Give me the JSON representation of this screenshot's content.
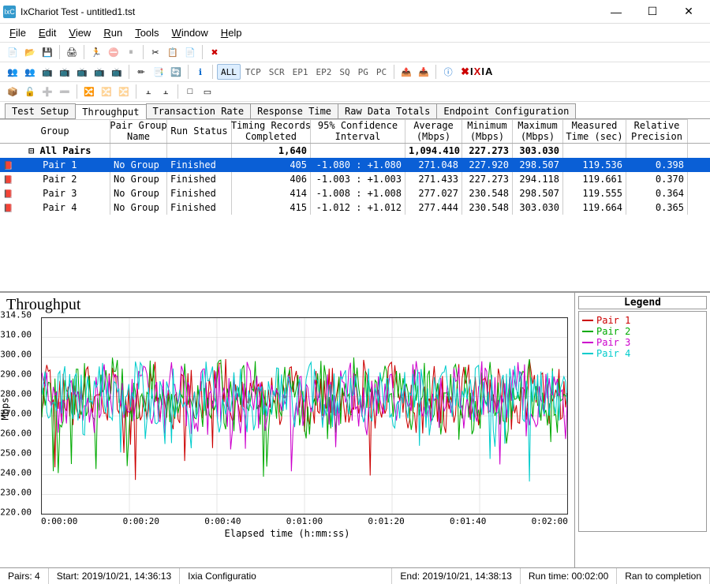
{
  "window": {
    "title": "IxChariot Test - untitled1.tst"
  },
  "menu": {
    "file": "File",
    "edit": "Edit",
    "view": "View",
    "run": "Run",
    "tools": "Tools",
    "window": "Window",
    "help": "Help"
  },
  "toolbar2": {
    "all": "ALL",
    "tcp": "TCP",
    "scr": "SCR",
    "ep1": "EP1",
    "ep2": "EP2",
    "sq": "SQ",
    "pg": "PG",
    "pc": "PC"
  },
  "tabs": [
    "Test Setup",
    "Throughput",
    "Transaction Rate",
    "Response Time",
    "Raw Data Totals",
    "Endpoint Configuration"
  ],
  "activeTab": 1,
  "columns": [
    "Group",
    "Pair Group\nName",
    "Run Status",
    "Timing Records\nCompleted",
    "95% Confidence\nInterval",
    "Average\n(Mbps)",
    "Minimum\n(Mbps)",
    "Maximum\n(Mbps)",
    "Measured\nTime (sec)",
    "Relative\nPrecision"
  ],
  "summary": {
    "label": "All Pairs",
    "timing": "1,640",
    "avg": "1,094.410",
    "min": "227.273",
    "max": "303.030"
  },
  "rows": [
    {
      "group": "Pair 1",
      "pg": "No Group",
      "status": "Finished",
      "timing": "405",
      "ci": "-1.080 : +1.080",
      "avg": "271.048",
      "min": "227.920",
      "max": "298.507",
      "time": "119.536",
      "prec": "0.398",
      "sel": true
    },
    {
      "group": "Pair 2",
      "pg": "No Group",
      "status": "Finished",
      "timing": "406",
      "ci": "-1.003 : +1.003",
      "avg": "271.433",
      "min": "227.273",
      "max": "294.118",
      "time": "119.661",
      "prec": "0.370",
      "sel": false
    },
    {
      "group": "Pair 3",
      "pg": "No Group",
      "status": "Finished",
      "timing": "414",
      "ci": "-1.008 : +1.008",
      "avg": "277.027",
      "min": "230.548",
      "max": "298.507",
      "time": "119.555",
      "prec": "0.364",
      "sel": false
    },
    {
      "group": "Pair 4",
      "pg": "No Group",
      "status": "Finished",
      "timing": "415",
      "ci": "-1.012 : +1.012",
      "avg": "277.444",
      "min": "230.548",
      "max": "303.030",
      "time": "119.664",
      "prec": "0.365",
      "sel": false
    }
  ],
  "chart_data": {
    "type": "line",
    "title": "Throughput",
    "ylabel": "Mbps",
    "xlabel": "Elapsed time (h:mm:ss)",
    "ylim": [
      215,
      315
    ],
    "yticks": [
      "314.50",
      "310.00",
      "300.00",
      "290.00",
      "280.00",
      "270.00",
      "260.00",
      "250.00",
      "240.00",
      "230.00",
      "220.00"
    ],
    "xticks": [
      "0:00:00",
      "0:00:20",
      "0:00:40",
      "0:01:00",
      "0:01:20",
      "0:01:40",
      "0:02:00"
    ],
    "series": [
      {
        "name": "Pair 1",
        "color": "#cc0000"
      },
      {
        "name": "Pair 2",
        "color": "#00aa00"
      },
      {
        "name": "Pair 3",
        "color": "#cc00cc"
      },
      {
        "name": "Pair 4",
        "color": "#00cccc"
      }
    ],
    "note": "Each series is noisy throughput ~230-300 Mbps over 0-120s; individual points approximated visually."
  },
  "legend_title": "Legend",
  "status": {
    "pairs": "Pairs: 4",
    "start": "Start: 2019/10/21, 14:36:13",
    "config": "Ixia Configuratio",
    "end": "End: 2019/10/21, 14:38:13",
    "runtime": "Run time: 00:02:00",
    "completion": "Ran to completion"
  }
}
